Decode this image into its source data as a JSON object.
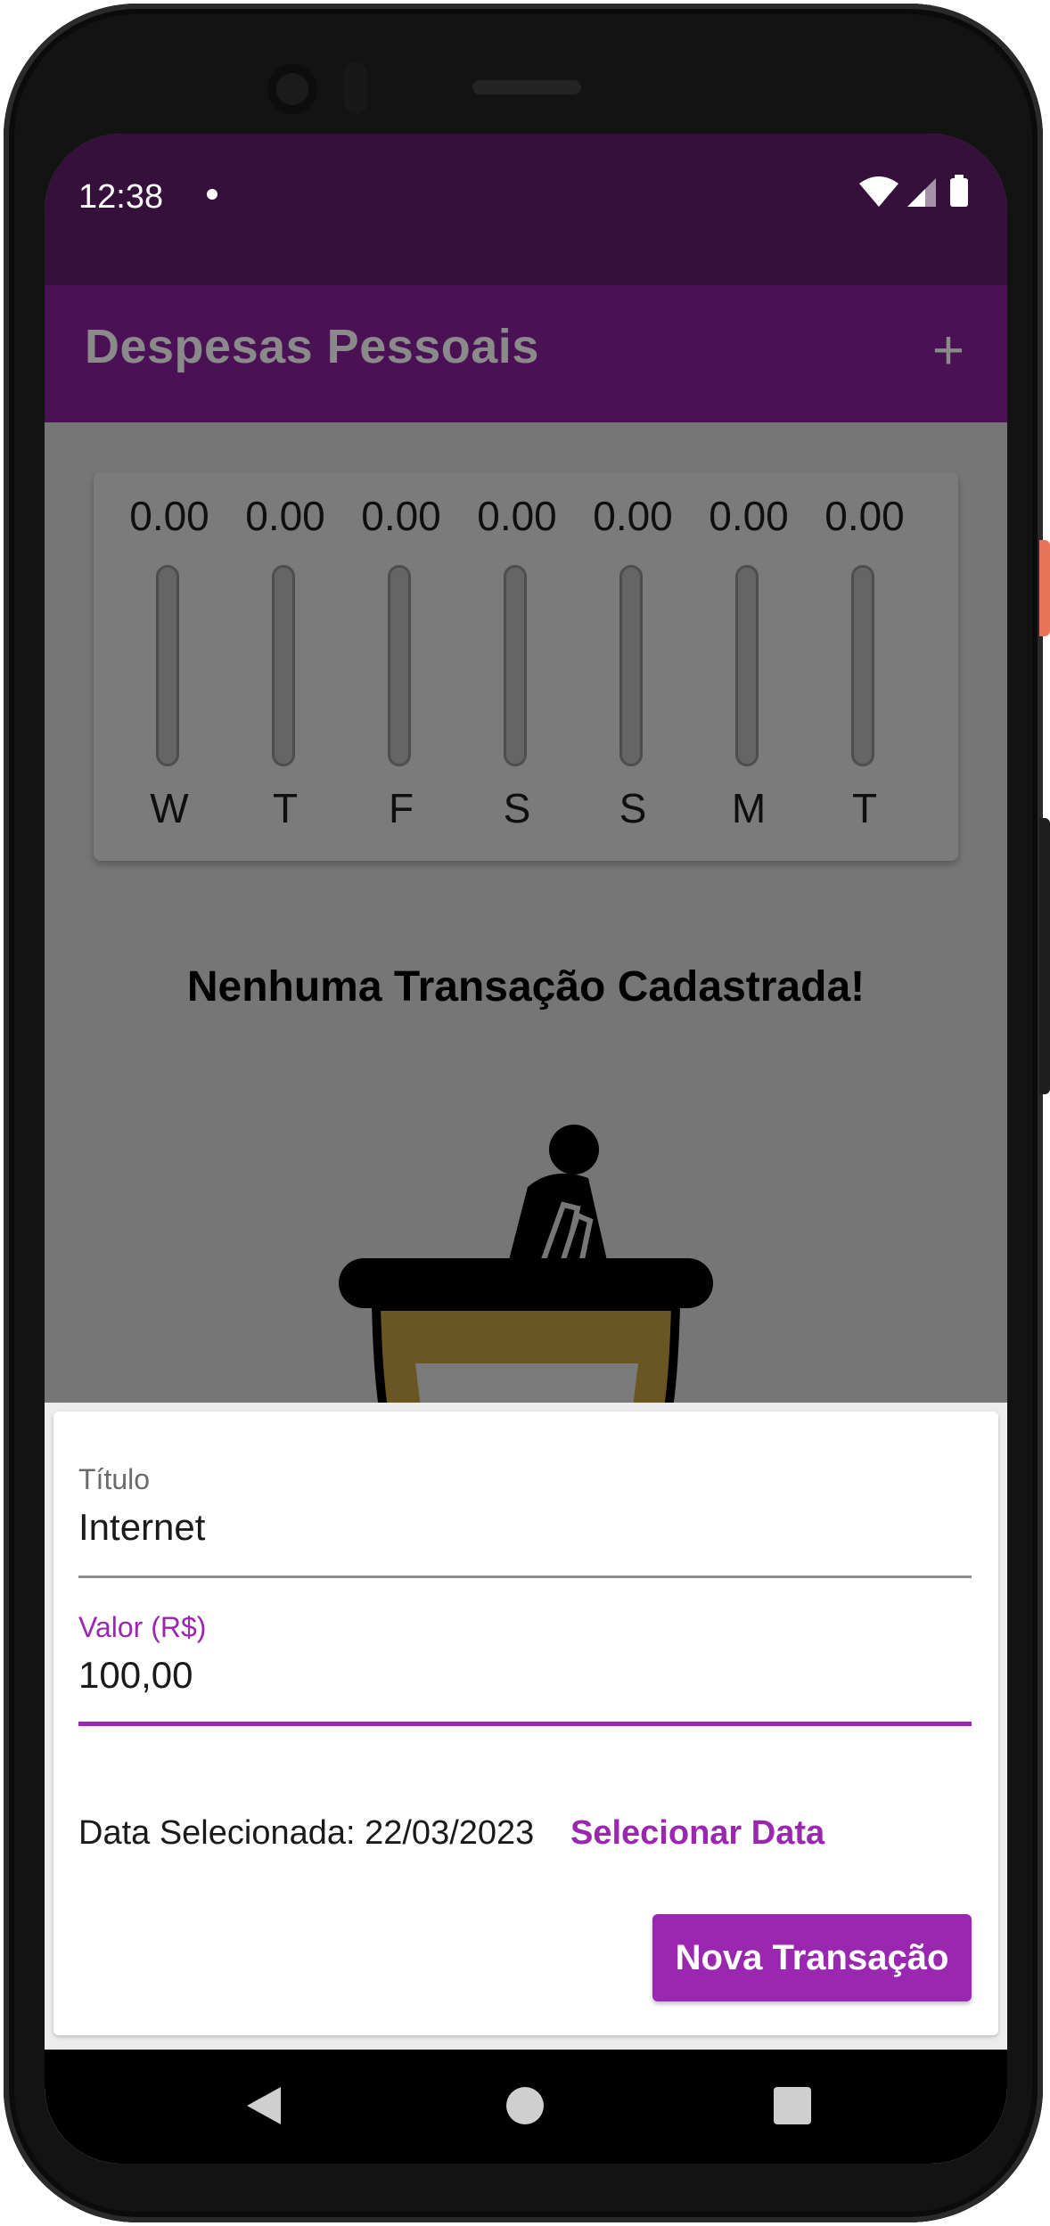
{
  "status_bar": {
    "time": "12:38"
  },
  "app_bar": {
    "title": "Despesas Pessoais",
    "add_icon": "plus-icon"
  },
  "chart_data": {
    "type": "bar",
    "categories": [
      "W",
      "T",
      "F",
      "S",
      "S",
      "M",
      "T"
    ],
    "values": [
      0,
      0,
      0,
      0,
      0,
      0,
      0
    ],
    "value_labels": [
      "0.00",
      "0.00",
      "0.00",
      "0.00",
      "0.00",
      "0.00",
      "0.00"
    ],
    "title": "",
    "xlabel": "",
    "ylabel": "",
    "ylim": [
      0,
      1
    ],
    "grid": false
  },
  "empty_state": {
    "message": "Nenhuma Transação Cadastrada!",
    "image_icon": "waiting-person-icon"
  },
  "form": {
    "title_label": "Título",
    "title_value": "Internet",
    "value_label": "Valor (R$)",
    "value_value": "100,00",
    "date_text": "Data Selecionada: 22/03/2023",
    "select_date_label": "Selecionar Data",
    "submit_label": "Nova Transação"
  },
  "colors": {
    "primary": "#9a27b0",
    "app_bar": "#4a1254",
    "status_bar": "#35103a"
  },
  "nav_bar": {
    "back_icon": "back-triangle-icon",
    "home_icon": "home-circle-icon",
    "recents_icon": "recents-square-icon"
  }
}
